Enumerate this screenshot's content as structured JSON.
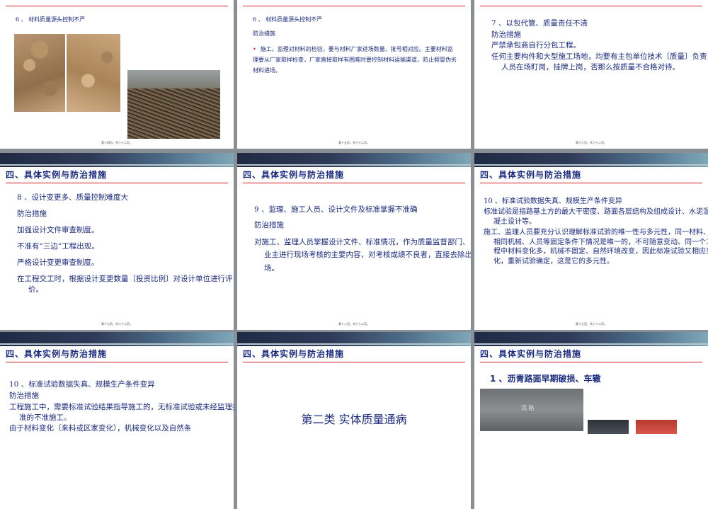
{
  "theme": {
    "heading_color": "#1a2a80",
    "rule_color": "#d02020",
    "background": "#8a8f96"
  },
  "section_heading": "四、具体实例与防治措施",
  "slides": {
    "s1": {
      "item": "6 、 材料质量源头控制不严",
      "footer": "第十四页，共六十二页。"
    },
    "s2": {
      "item": "6 、 材料质量源头控制不严",
      "sub": "防治措施",
      "bullet_mark": "•",
      "body": "施工、监理对材料的检验，要与材料厂家进场数量、批号相对应。主要材料监理要从厂家取样检查，厂家直接取样有困难时要控制材料运输渠道，防止假冒伪劣材料进场。",
      "footer": "第十五页，共六十二页。"
    },
    "s3": {
      "item": "7 、以包代管、质量责任不清",
      "sub": "防治措施",
      "line1": "严禁承包商自行分包工程。",
      "body": "任何主要构件和大型施工场地，均要有主包单位技术〔质量〕负责人员在场盯岗，挂牌上岗，否那么按质量不合格对待。",
      "footer": "第十六页，共六十二页。"
    },
    "s4": {
      "item": "8 、设计变更多、质量控制难度大",
      "sub": "防治措施",
      "l1": "加强设计文件审查制度。",
      "l2": "不准有“三边”工程出现。",
      "l3": "严格设计变更审查制度。",
      "l4": "在工程交工时，根据设计变更数量〔投资比例〕对设计单位进行评价。",
      "footer": "第十七页，共六十二页。"
    },
    "s5": {
      "item": "9 、监理、施工人员、设计文件及标准掌握不准确",
      "sub": "防治措施",
      "body": "对施工、监理人员掌握设计文件、标准情况，作为质量监督部门、业主进行现场考核的主要内容，对考核成绩不良者，直接去除出场。",
      "footer": "第十八页，共六十二页。"
    },
    "s6": {
      "item": "10 、标准试验数据失真、规模生产条件变异",
      "p1": "标准试验是指路基土方的最大干密度、路面各层结构及组成设计、水泥混凝土设计等。",
      "p2": "施工、监理人员要充分认识理解标准试验的唯一性与多元性，同一材料、相同机械、人员等固定条件下情况是唯一的，不可随意变动。同一个工程中材料变化多，机械不固定、自然环境改变，因此标准试验又相应变化，重新试验确定，这是它的多元性。",
      "footer": "第十九页，共六十二页。"
    },
    "s7": {
      "item": "10 、标准试验数据失真、规模生产条件变异",
      "sub": "防治措施",
      "body": "工程施工中，需要标准试验结果指导施工的，无标准试验或未经监理批准的不准施工。",
      "cut": "由于材料变化（来料或区家变化），机械变化以及自然条"
    },
    "s8": {
      "title": "第二类 实体质量通病"
    },
    "s9": {
      "title": "1 、沥青路面早期破损、车辙",
      "photo_label": "沉   陷"
    }
  }
}
